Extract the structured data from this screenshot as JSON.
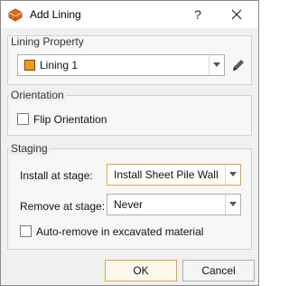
{
  "window": {
    "title": "Add Lining",
    "help_label": "?"
  },
  "lining_property": {
    "group_title": "Lining Property",
    "selected_value": "Lining 1",
    "swatch_color": "#f39c12"
  },
  "orientation": {
    "group_title": "Orientation",
    "flip_label": "Flip Orientation",
    "flip_checked": false
  },
  "staging": {
    "group_title": "Staging",
    "install_label": "Install at stage:",
    "install_value": "Install Sheet Pile Wall",
    "remove_label": "Remove at stage:",
    "remove_value": "Never",
    "auto_remove_label": "Auto-remove in excavated material",
    "auto_remove_checked": false
  },
  "buttons": {
    "ok_label": "OK",
    "cancel_label": "Cancel"
  },
  "colors": {
    "accent_border": "#d9a93a",
    "swatch": "#f39c12"
  }
}
